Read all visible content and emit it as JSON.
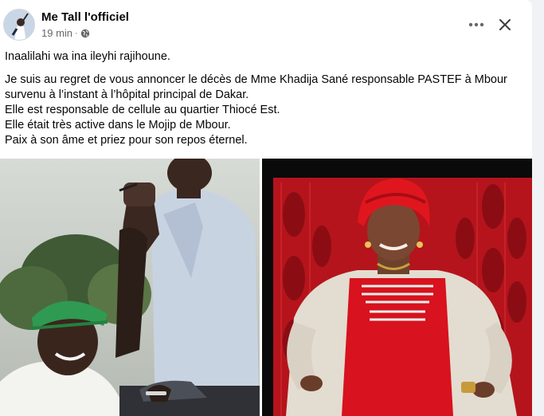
{
  "post": {
    "author": "Me Tall l'officiel",
    "time": "19 min",
    "separator": "·",
    "privacy_icon": "globe-icon",
    "paragraphs": [
      "Inaalilahi wa ina ileyhi rajihoune.",
      "Je suis au regret de vous annoncer le décès de Mme Khadija Sané responsable PASTEF à Mbour survenu à l’instant à l’hôpital principal de Dakar.",
      "Elle est responsable de cellule au quartier Thiocé Est.",
      "Elle était très active dans le Mojip de Mbour.",
      "Paix à son âme et priez pour son repos éternel."
    ]
  },
  "controls": {
    "more_icon": "more-options-icon",
    "close_icon": "close-icon"
  },
  "colors": {
    "background": "#f0f2f5",
    "card": "#ffffff",
    "secondary_text": "#65676b"
  }
}
